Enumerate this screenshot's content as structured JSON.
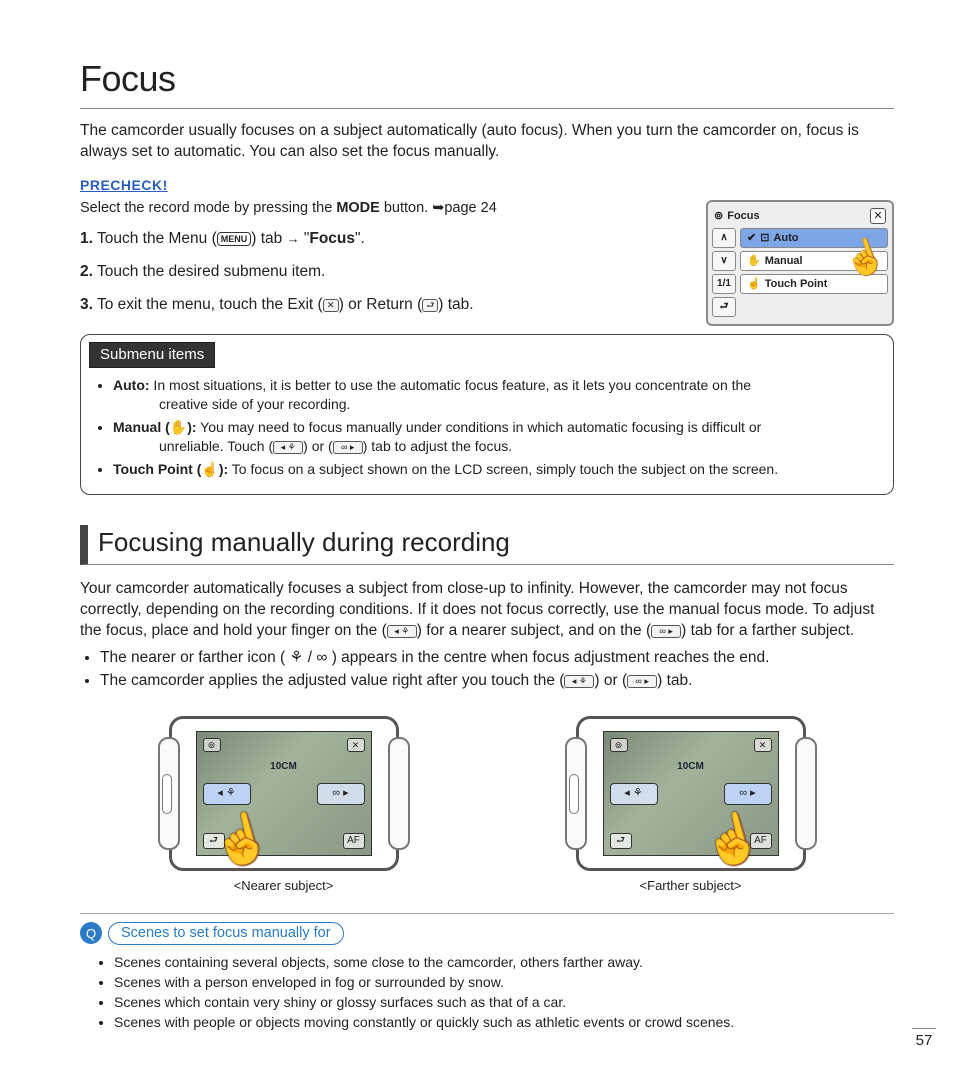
{
  "page": {
    "title": "Focus",
    "intro": "The camcorder usually focuses on a subject automatically (auto focus). When you turn the camcorder on, focus is always set to automatic. You can also set the focus manually.",
    "precheck_label": "PRECHECK!",
    "precheck_text_a": "Select the record mode by pressing the ",
    "precheck_text_mode": "MODE",
    "precheck_text_b": " button. ➥page 24",
    "number": "57"
  },
  "steps": {
    "s1_num": "1.",
    "s1_a": "Touch the Menu (",
    "s1_menu_badge": "MENU",
    "s1_b": ") tab ",
    "s1_arrow": "→",
    "s1_c": " \"",
    "s1_focus": "Focus",
    "s1_d": "\".",
    "s2_num": "2.",
    "s2_text": "Touch the desired submenu item.",
    "s3_num": "3.",
    "s3_a": "To exit the menu, touch the Exit (",
    "s3_x": "✕",
    "s3_b": ") or Return (",
    "s3_ret": "⮐",
    "s3_c": ") tab."
  },
  "menu_panel": {
    "title": "Focus",
    "close": "✕",
    "up": "∧",
    "down": "∨",
    "page_indicator": "1/1",
    "return": "⮐",
    "item_auto_check": "✔",
    "item_auto": "Auto",
    "item_manual": "Manual",
    "item_touch": "Touch Point"
  },
  "submenu": {
    "heading": "Submenu items",
    "auto_label": "Auto:",
    "auto_text_a": " In most situations, it is better to use the automatic focus feature, as it lets you concentrate on the",
    "auto_text_b": "creative side of your recording.",
    "manual_label": "Manual (",
    "manual_icon": "✋",
    "manual_label2": "):",
    "manual_text_a": " You may need to focus manually under conditions in which automatic focusing is difficult or",
    "manual_text_b_a": "unreliable. Touch (",
    "manual_near": "◂ ⚘",
    "manual_text_b_b": ") or (",
    "manual_far": "∞ ▸",
    "manual_text_b_c": ") tab to adjust the focus.",
    "touch_label": "Touch Point (",
    "touch_icon": "☝",
    "touch_label2": "):",
    "touch_text": " To focus on a subject shown on the LCD screen, simply touch the subject on the screen."
  },
  "section2": {
    "heading": "Focusing manually during recording",
    "para_a": "Your camcorder automatically focuses a subject from close-up to infinity. However, the camcorder may not focus correctly, depending on the recording conditions. If it does not focus correctly, use the manual focus mode. To adjust the focus, place and hold your finger on the (",
    "near_btn": "◂ ⚘",
    "para_b": ") for a nearer subject, and on the (",
    "far_btn": "∞ ▸",
    "para_c": ") tab for a farther subject.",
    "bullet1_a": "The nearer or farther icon ( ",
    "bullet1_icons": "⚘ / ∞",
    "bullet1_b": " ) appears in the centre when focus adjustment reaches the end.",
    "bullet2_a": "The camcorder applies the adjusted value right after you touch the (",
    "bullet2_b": ") or (",
    "bullet2_c": ") tab."
  },
  "cams": {
    "near_distance": "10CM",
    "near_caption": "<Nearer subject>",
    "far_distance": "10CM",
    "far_caption": "<Farther subject>",
    "btn_near": "◂ ⚘",
    "btn_far": "∞ ▸",
    "chip_x": "✕",
    "chip_ret": "⮐",
    "chip_af": "AF"
  },
  "scenes": {
    "mag": "🔍",
    "heading": "Scenes to set focus manually for",
    "items": [
      "Scenes containing several objects, some close to the camcorder, others farther away.",
      "Scenes with a person enveloped in fog or surrounded by snow.",
      "Scenes which contain very shiny or glossy surfaces such as that of a car.",
      "Scenes with people or objects moving constantly or quickly such as athletic events or crowd scenes."
    ]
  }
}
